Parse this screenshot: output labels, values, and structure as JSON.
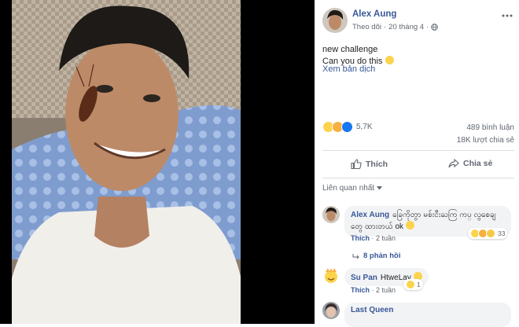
{
  "post": {
    "author": "Alex Aung",
    "follow_label": "Theo dõi",
    "date": "20 tháng 4",
    "privacy_icon": "globe-icon",
    "text_line1": "new challenge",
    "text_line2": "Can you do this",
    "see_translation": "Xem bản dịch",
    "reaction_count": "5,7K",
    "comments_count": "489 bình luận",
    "shares_count": "18K lượt chia sẻ",
    "like_label": "Thích",
    "share_label": "Chia sẻ",
    "sort_label": "Liên quan nhất"
  },
  "comments": [
    {
      "author": "Alex Aung",
      "text": "ခြေကိုတွာ မစ်းငီးႀကြ ကပ္ လွစေချတွေ ထားတယ် ok",
      "like": "Thích",
      "time": "2 tuần",
      "reaction_count": "33",
      "replies": "8 phản hồi"
    },
    {
      "author": "Su Pan",
      "text": "HtweLay",
      "like": "Thích",
      "time": "2 tuần",
      "reaction_count": "1"
    },
    {
      "author": "Last Queen"
    }
  ],
  "colors": {
    "link": "#385898",
    "secondary_text": "#606770",
    "bubble": "#f2f3f5",
    "like_blue": "#1877f2",
    "haha_yellow": "#fcd34d"
  }
}
